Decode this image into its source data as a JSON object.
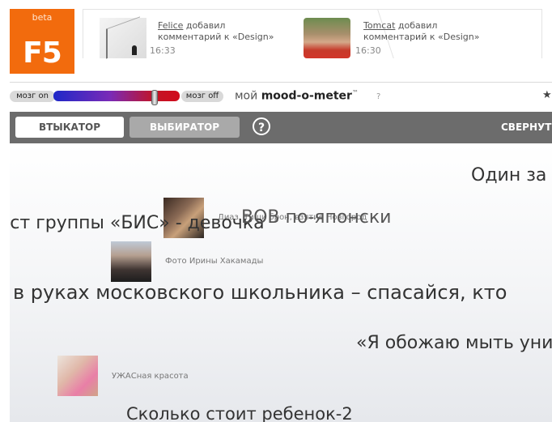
{
  "logo": {
    "badge": "beta",
    "text": "F5"
  },
  "feed": [
    {
      "user": "Felice",
      "action": "добавил",
      "text": "комментарий к «Design»",
      "time": "16:33"
    },
    {
      "user": "Tomcat",
      "action": "добавил",
      "text": "комментарий к «Design»",
      "time": "16:30"
    }
  ],
  "mood": {
    "brain_on": "мозг on",
    "brain_off": "мозг off",
    "label_prefix": "мой",
    "label_main": "mood-o-meter",
    "label_mark": "™",
    "help": "?",
    "star": "★",
    "level": 0.82,
    "colors": {
      "start": "#1e28c8",
      "end": "#d10b1b"
    }
  },
  "toolbar": {
    "vtyk": "ВТЫКАТОР",
    "vybir": "ВЫБИРАТОР",
    "help": "?",
    "collapse": "СВЕРНУТЬ"
  },
  "cloud": {
    "headlines": [
      "Один за",
      "ист группы «БИС» - девочка",
      "ВОВ по-японски",
      "в руках московского школьника – спасайся, кто",
      "«Я обожаю мыть уни",
      "Сколько стоит ребенок-2"
    ],
    "captions": [
      "Диаз, Тиши брон, взятие Новгород",
      "Фото Ирины Хакамады",
      "УЖАСная красота"
    ]
  },
  "colors": {
    "brand": "#f26b0d",
    "toolbar": "#6c6c6c"
  }
}
